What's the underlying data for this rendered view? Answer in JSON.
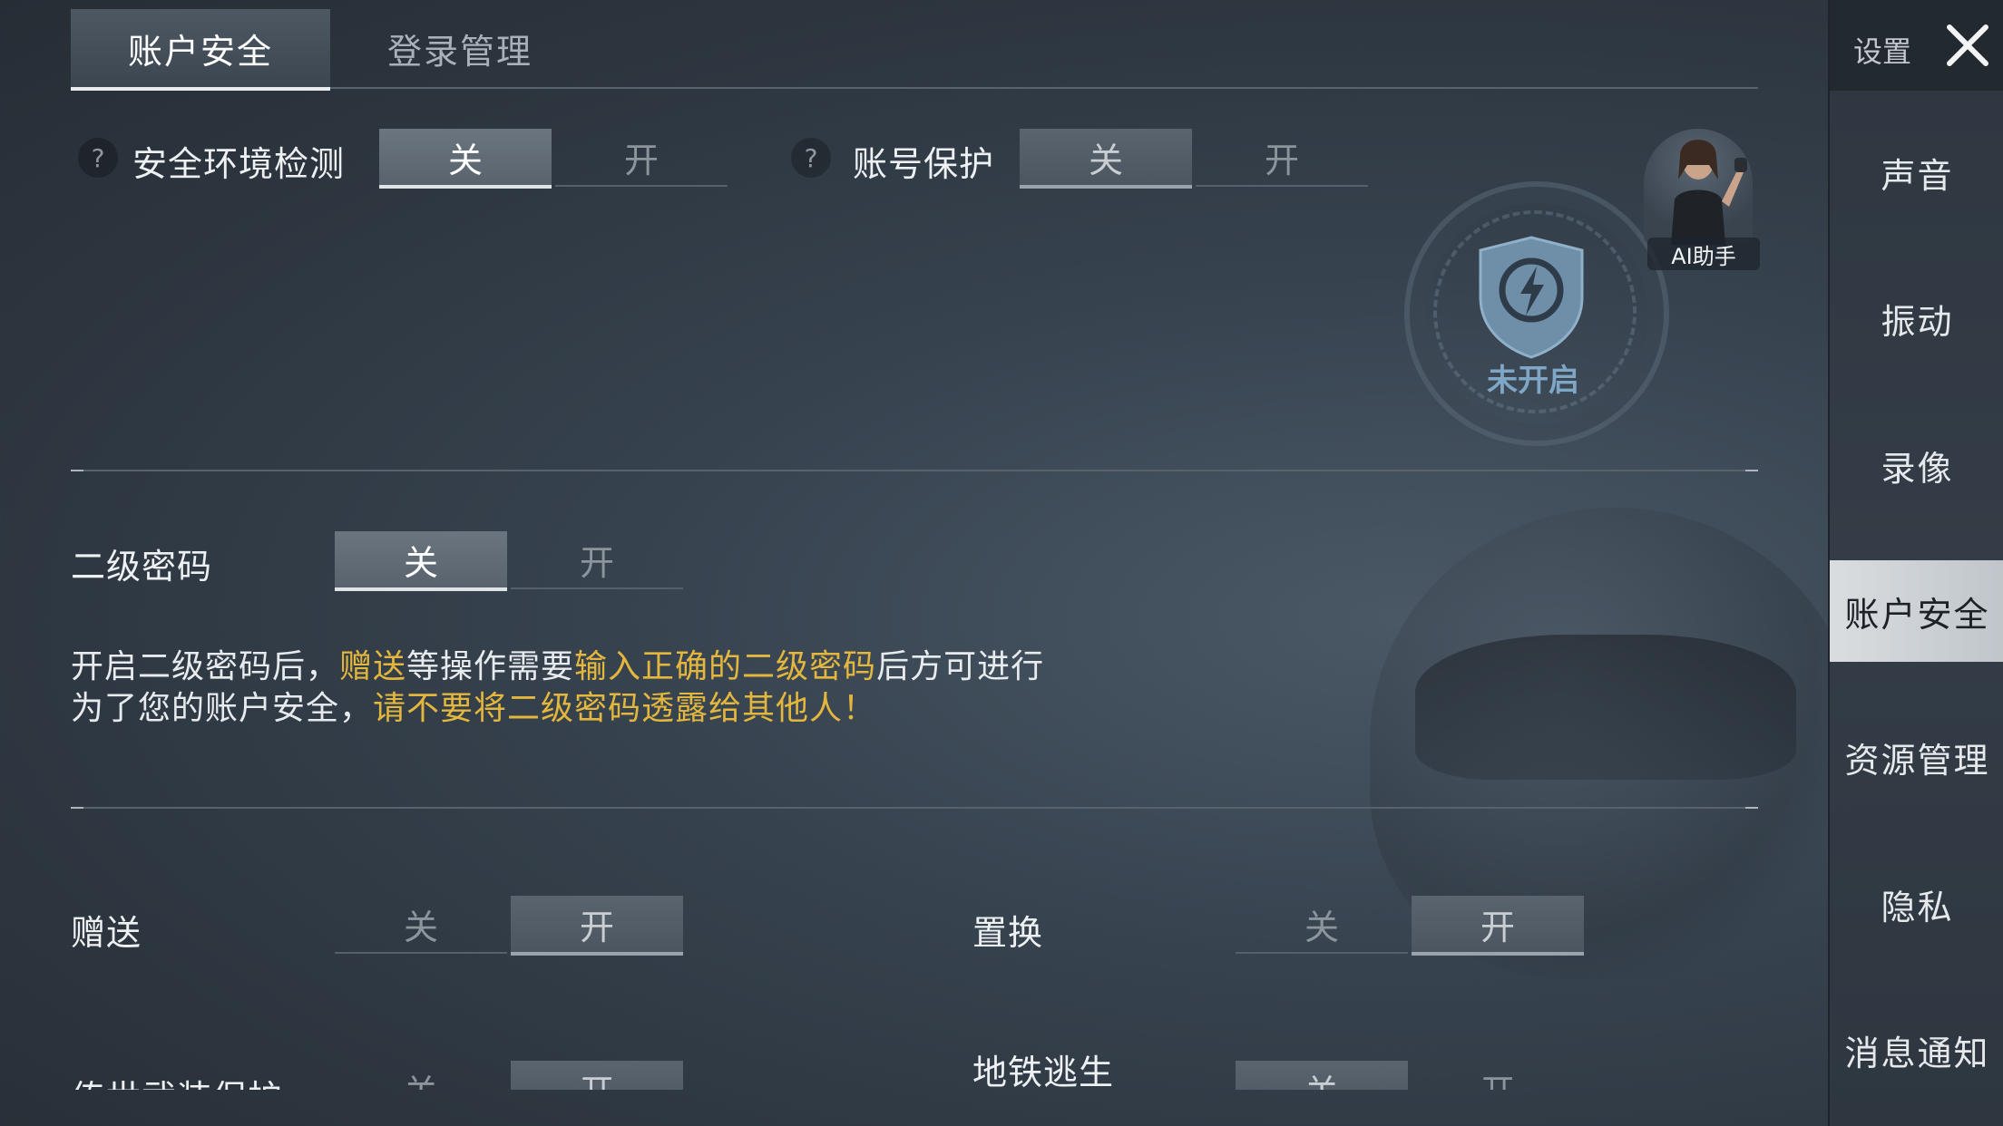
{
  "tabs": {
    "account_security": "账户安全",
    "login_management": "登录管理"
  },
  "toggle_labels": {
    "off": "关",
    "on": "开"
  },
  "security_env": {
    "label": "安全环境检测",
    "help": "?"
  },
  "account_protect": {
    "label": "账号保护",
    "help": "?"
  },
  "badge": {
    "status": "未开启"
  },
  "ai_helper": {
    "label": "AI助手"
  },
  "second_password": {
    "label": "二级密码",
    "desc_line1_a": "开启二级密码后，",
    "desc_line1_b": "赠送",
    "desc_line1_c": "等操作需要",
    "desc_line1_d": "输入正确的二级密码",
    "desc_line1_e": "后方可进行",
    "desc_line2_a": "为了您的账户安全，",
    "desc_line2_b": "请不要将二级密码透露给其他人！"
  },
  "gift": {
    "label": "赠送"
  },
  "exchange": {
    "label": "置换"
  },
  "legend_weapon": {
    "label": "传世武装保护"
  },
  "metro": {
    "label": "地铁逃生"
  },
  "sidebar": {
    "title": "设置",
    "items": [
      "声音",
      "振动",
      "录像",
      "账户安全",
      "资源管理",
      "隐私",
      "消息通知"
    ]
  },
  "colors": {
    "highlight": "#e3b63d",
    "accent_badge": "#7fa6c4"
  }
}
